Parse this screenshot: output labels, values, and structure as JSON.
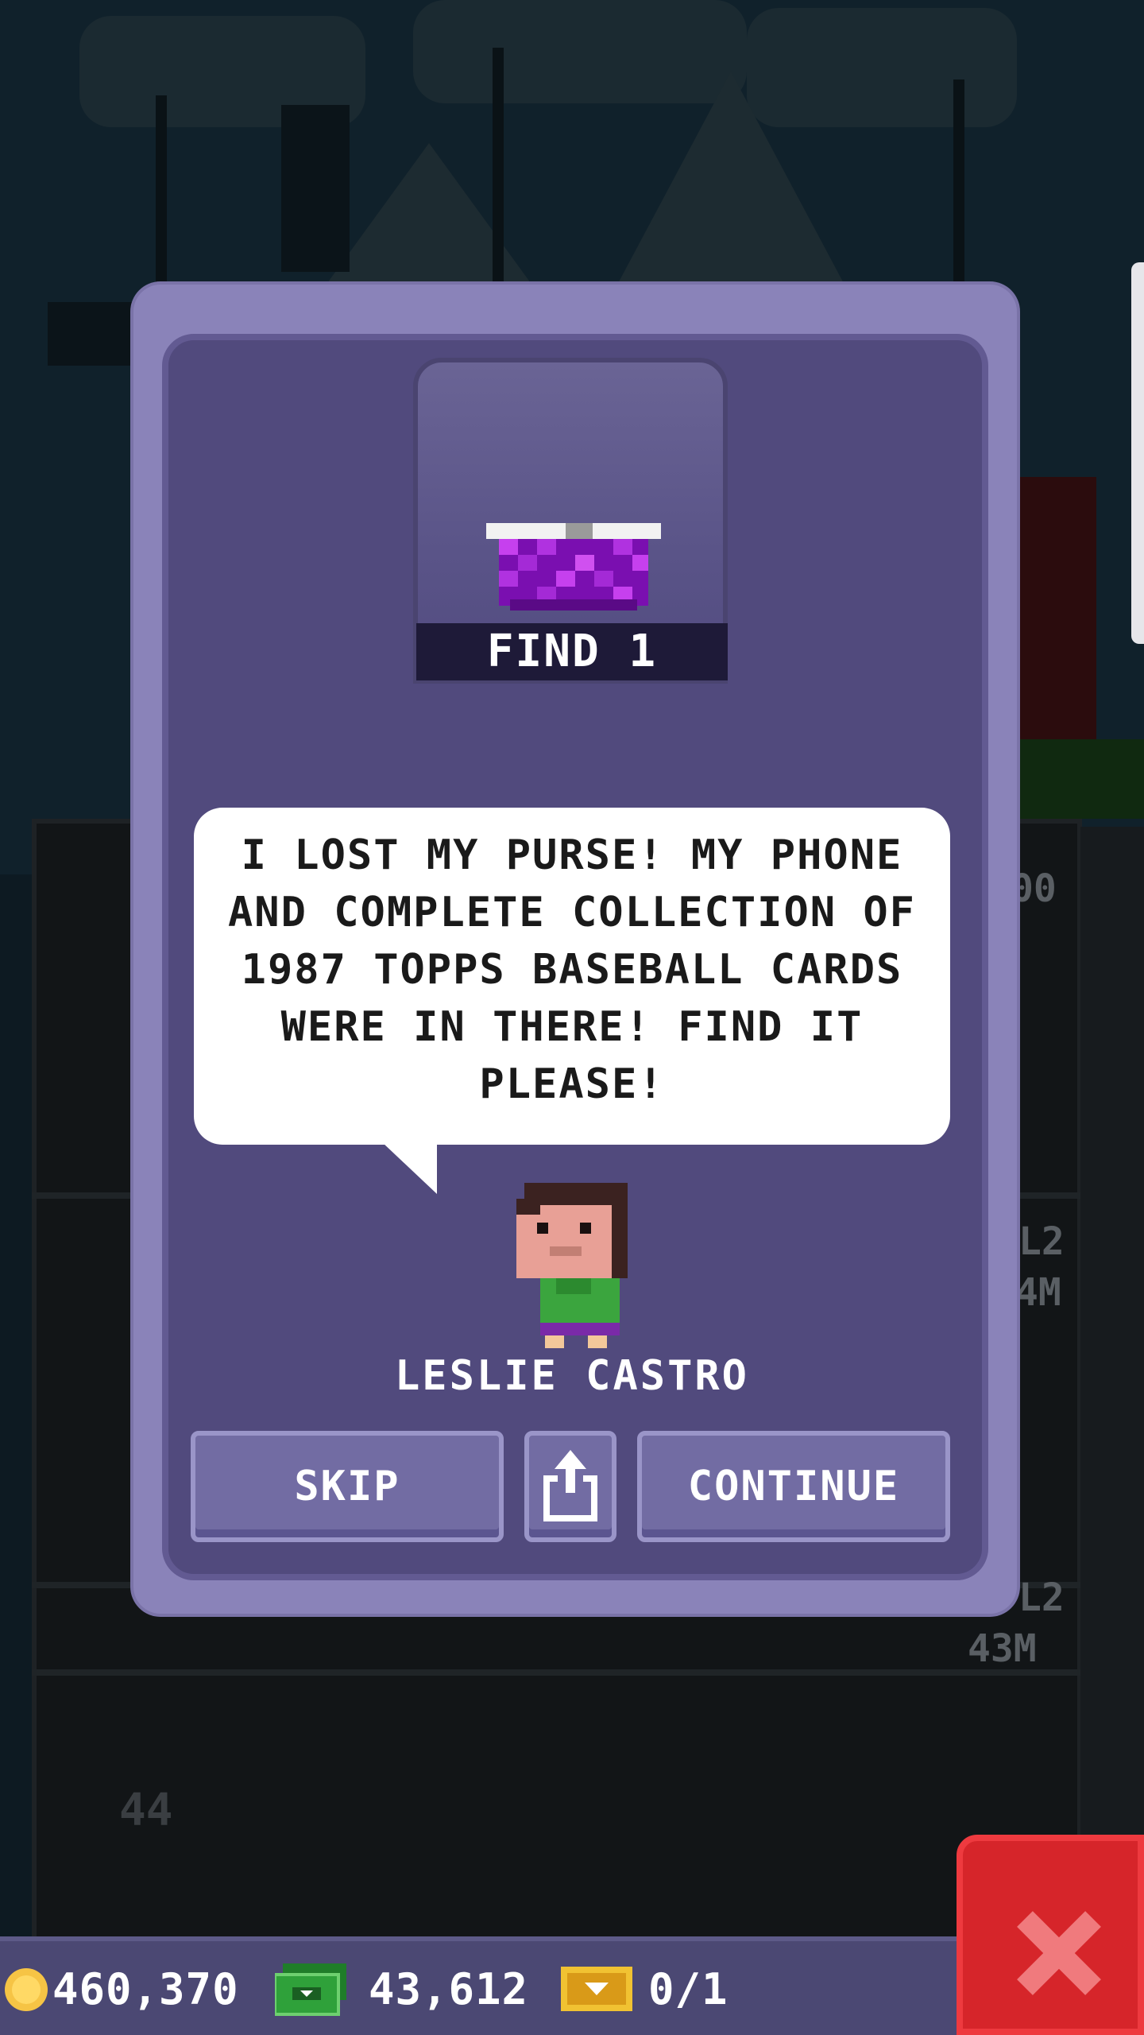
{
  "dialog": {
    "item_caption": "FIND 1",
    "message": "I LOST MY PURSE! MY PHONE AND COMPLETE COLLECTION OF 1987 TOPPS BASEBALL CARDS WERE IN THERE! FIND IT PLEASE!",
    "character_name": "LESLIE CASTRO",
    "buttons": {
      "skip": "SKIP",
      "continue": "CONTINUE"
    },
    "icons": {
      "item": "purse-icon",
      "share": "share-icon",
      "character": "resident-avatar"
    }
  },
  "background": {
    "floor_tags": [
      "00",
      "L2",
      "4M",
      "L2",
      "43M"
    ],
    "floor_number": "44"
  },
  "status_bar": {
    "coins": "460,370",
    "bux": "43,612",
    "tickets": "0/1",
    "icons": [
      "coin-icon",
      "bux-icon",
      "ticket-icon"
    ]
  },
  "colors": {
    "dialog": "#8a83b9",
    "dialog_inner": "#514a7d",
    "button": "#726ca3",
    "close_button": "#d6252a",
    "coin": "#f6c445",
    "bux": "#2fa13a",
    "ticket": "#f1c232"
  }
}
